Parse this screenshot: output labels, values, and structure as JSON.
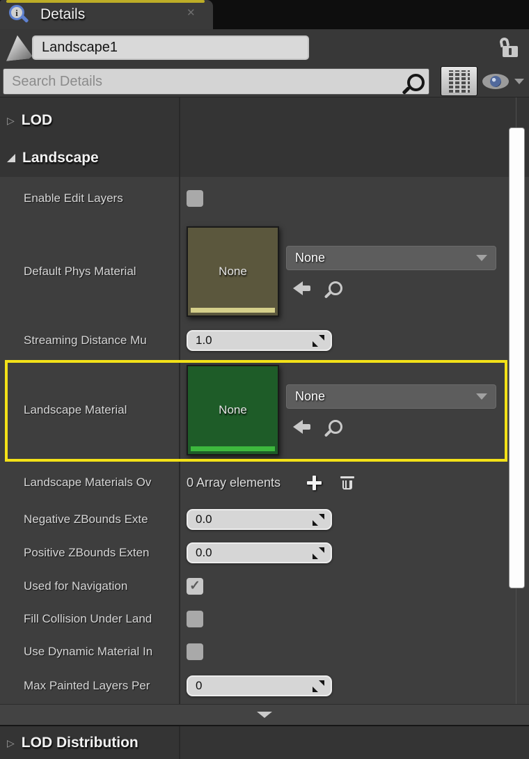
{
  "tab": {
    "title": "Details"
  },
  "icons": {
    "close": "✕",
    "check": "✓",
    "collapsed_arrow": "▷",
    "info_i": "i"
  },
  "object_header": {
    "name": "Landscape1"
  },
  "search": {
    "placeholder": "Search Details"
  },
  "sections": [
    {
      "id": "lod",
      "label": "LOD",
      "state": "collapsed"
    },
    {
      "id": "landscape",
      "label": "Landscape",
      "state": "expanded"
    },
    {
      "id": "lod_distribution",
      "label": "LOD Distribution",
      "state": "collapsed"
    }
  ],
  "properties": {
    "enable_edit_layers": {
      "label": "Enable Edit Layers",
      "checked": false
    },
    "default_phys_material": {
      "label": "Default Phys Material",
      "thumbnail_text": "None",
      "dropdown_value": "None"
    },
    "streaming_distance_multiplier": {
      "label": "Streaming Distance Mu",
      "value": "1.0"
    },
    "landscape_material": {
      "label": "Landscape Material",
      "thumbnail_text": "None",
      "dropdown_value": "None",
      "highlighted": true
    },
    "landscape_materials_override": {
      "label": "Landscape Materials Ov",
      "value": "0 Array elements"
    },
    "negative_zbounds_extension": {
      "label": "Negative ZBounds Exte",
      "value": "0.0"
    },
    "positive_zbounds_extension": {
      "label": "Positive ZBounds Exten",
      "value": "0.0"
    },
    "used_for_navigation": {
      "label": "Used for Navigation",
      "checked": true
    },
    "fill_collision_under_landscape": {
      "label": "Fill Collision Under Land",
      "checked": false
    },
    "use_dynamic_material_instance": {
      "label": "Use Dynamic Material In",
      "checked": false
    },
    "max_painted_layers_per_component": {
      "label": "Max Painted Layers Per",
      "value": "0"
    }
  },
  "colors": {
    "highlight_yellow": "#f3e118",
    "tab_accent": "#bdad27",
    "phys_thumbnail": "#5b573d",
    "phys_thumbnail_stripe": "#d5cf8a",
    "material_thumbnail": "#1e5c28",
    "material_thumbnail_stripe": "#3db83d",
    "panel_background": "#383838"
  }
}
